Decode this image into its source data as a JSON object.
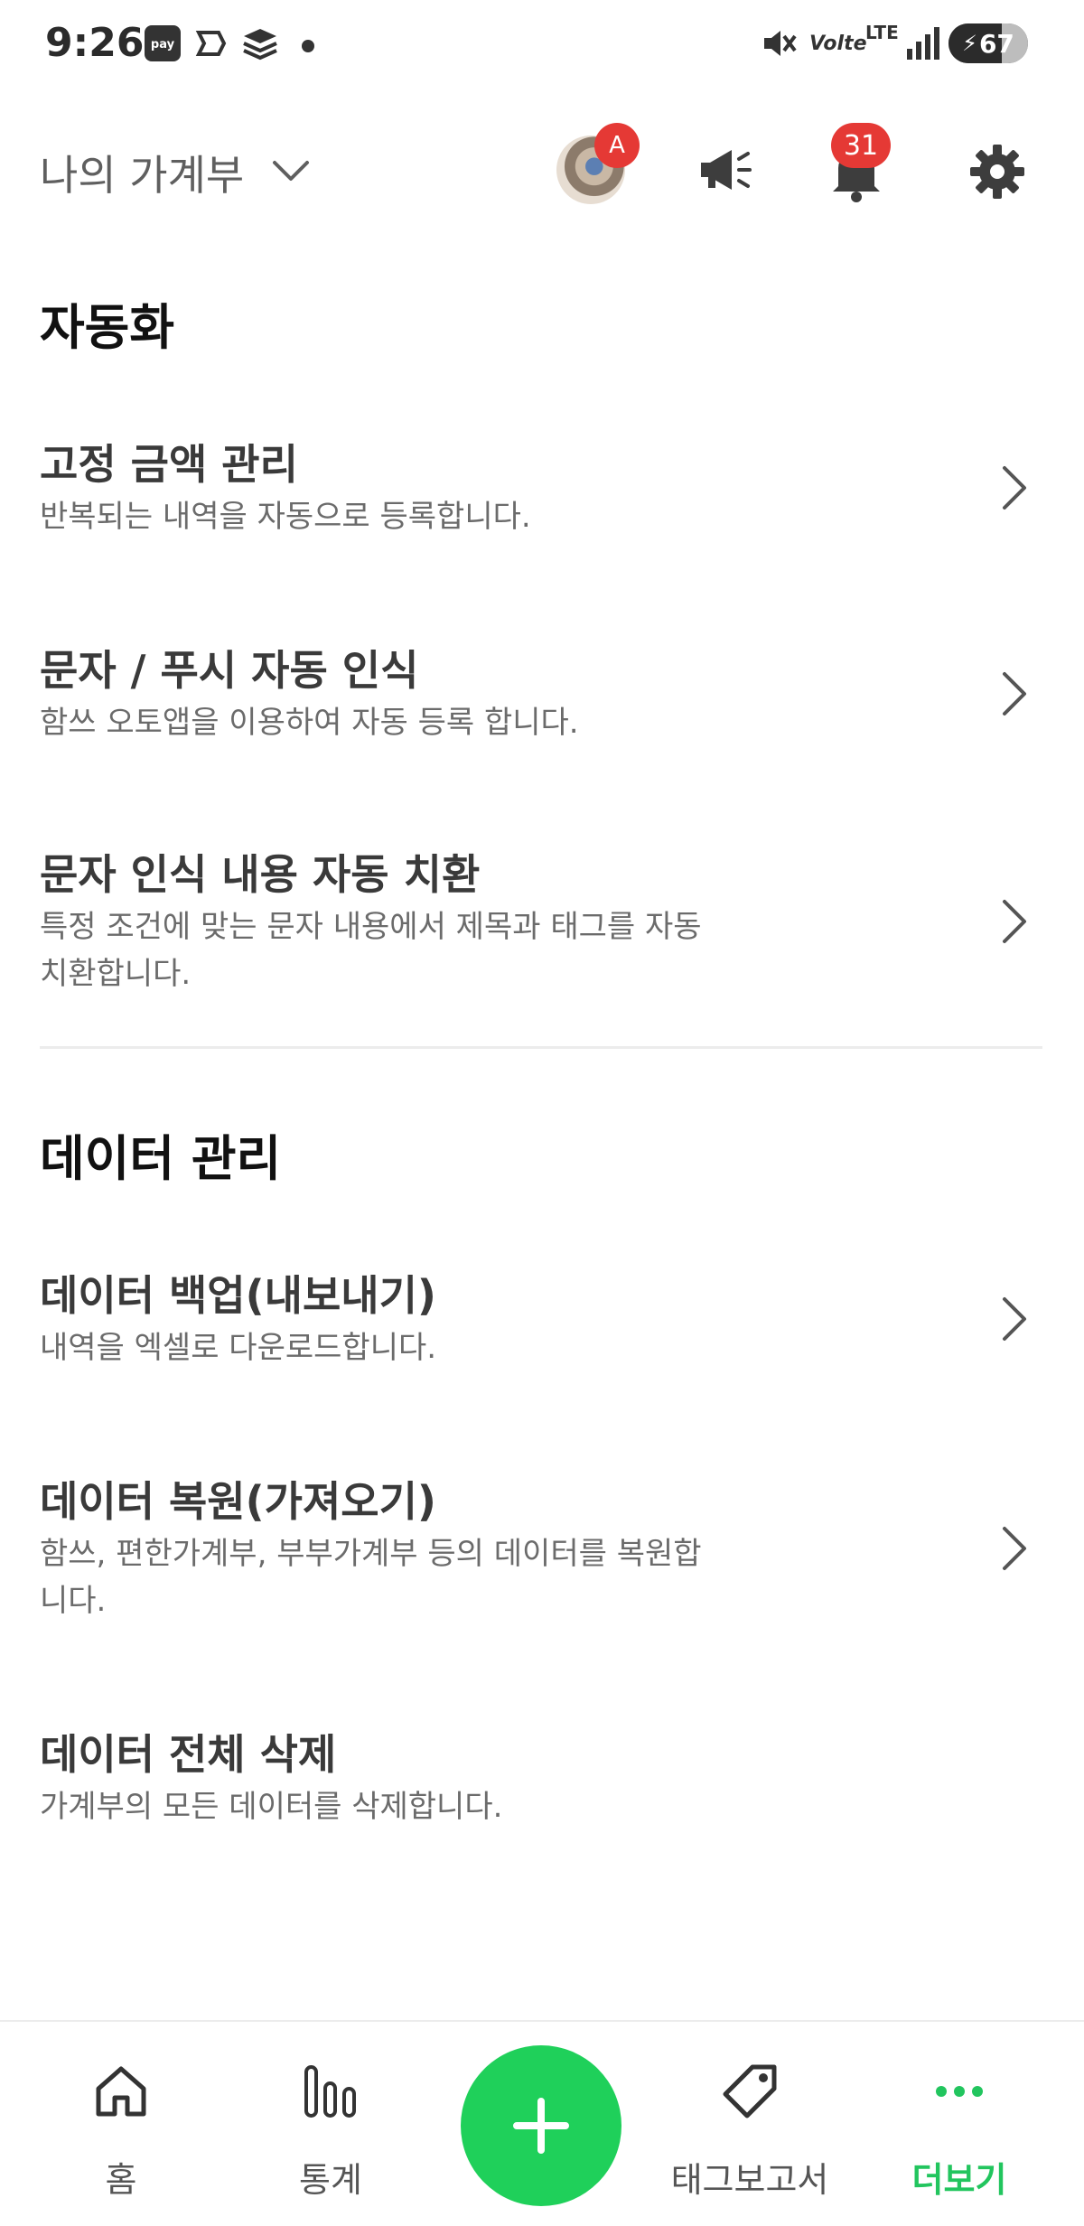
{
  "status_bar": {
    "time": "9:26",
    "battery": "67",
    "battery_level": 0.67,
    "network": "LTE",
    "volte": "Volte"
  },
  "header": {
    "book_name": "나의 가계부",
    "avatar_badge": "A",
    "bell_badge": "31"
  },
  "sections": [
    {
      "title": "자동화",
      "items": [
        {
          "title": "고정 금액 관리",
          "desc": "반복되는 내역을 자동으로 등록합니다."
        },
        {
          "title": "문자 / 푸시 자동 인식",
          "desc": "함쓰 오토앱을 이용하여 자동 등록 합니다."
        },
        {
          "title": "문자 인식 내용 자동 치환",
          "desc": "특정 조건에 맞는 문자 내용에서 제목과 태그를 자동 치환합니다."
        }
      ]
    },
    {
      "title": "데이터 관리",
      "items": [
        {
          "title": "데이터 백업(내보내기)",
          "desc": "내역을 엑셀로 다운로드합니다."
        },
        {
          "title": "데이터 복원(가져오기)",
          "desc": "함쓰, 편한가계부, 부부가계부 등의 데이터를 복원합니다."
        },
        {
          "title": "데이터 전체 삭제",
          "desc": "가계부의 모든 데이터를 삭제합니다."
        }
      ]
    }
  ],
  "nav": {
    "home": "홈",
    "stats": "통계",
    "tag_report": "태그보고서",
    "more": "더보기"
  },
  "colors": {
    "accent": "#22c55e",
    "fab": "#1fd05a",
    "badge": "#e53935"
  }
}
